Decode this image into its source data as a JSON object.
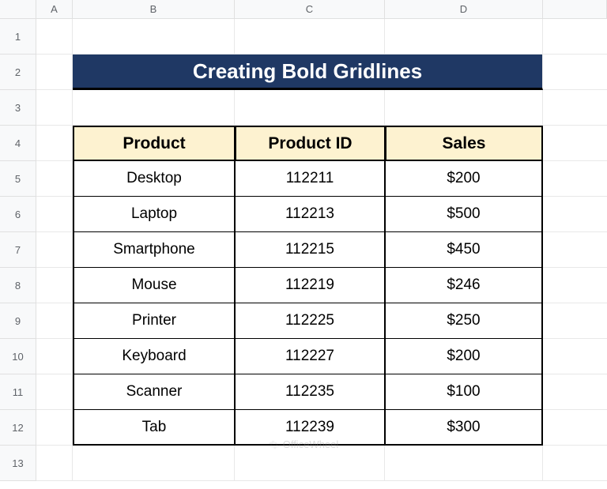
{
  "columns": [
    "A",
    "B",
    "C",
    "D"
  ],
  "rows": [
    "1",
    "2",
    "3",
    "4",
    "5",
    "6",
    "7",
    "8",
    "9",
    "10",
    "11",
    "12",
    "13"
  ],
  "title": "Creating Bold Gridlines",
  "table": {
    "headers": [
      "Product",
      "Product ID",
      "Sales"
    ],
    "data": [
      {
        "product": "Desktop",
        "id": "112211",
        "sales": "$200"
      },
      {
        "product": "Laptop",
        "id": "112213",
        "sales": "$500"
      },
      {
        "product": "Smartphone",
        "id": "112215",
        "sales": "$450"
      },
      {
        "product": "Mouse",
        "id": "112219",
        "sales": "$246"
      },
      {
        "product": "Printer",
        "id": "112225",
        "sales": "$250"
      },
      {
        "product": "Keyboard",
        "id": "112227",
        "sales": "$200"
      },
      {
        "product": "Scanner",
        "id": "112235",
        "sales": "$100"
      },
      {
        "product": "Tab",
        "id": "112239",
        "sales": "$300"
      }
    ]
  },
  "watermark": "OfficeWheel"
}
